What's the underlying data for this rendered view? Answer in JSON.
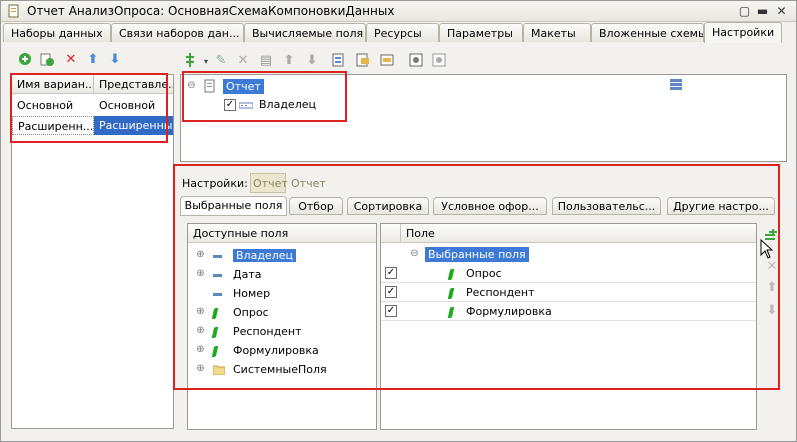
{
  "window": {
    "title": "Отчет АнализОпроса: ОсновнаяСхемаКомпоновкиДанных"
  },
  "tabs": [
    "Наборы данных",
    "Связи наборов дан...",
    "Вычисляемые поля",
    "Ресурсы",
    "Параметры",
    "Макеты",
    "Вложенные схемы",
    "Настройки"
  ],
  "variants": {
    "columns": [
      "Имя вариан...",
      "Представле..."
    ],
    "rows": [
      {
        "name": "Основной",
        "presentation": "Основной"
      },
      {
        "name": "Расширенн...",
        "presentation": "Расширенный"
      }
    ]
  },
  "structure": {
    "root": "Отчет",
    "child": "Владелец"
  },
  "settings": {
    "label": "Настройки:",
    "mode_active": "Отчет",
    "mode_other": "Отчет"
  },
  "subtabs": [
    "Выбранные поля",
    "Отбор",
    "Сортировка",
    "Условное офор...",
    "Пользовательс...",
    "Другие настро..."
  ],
  "available": {
    "header": "Доступные поля",
    "items": [
      {
        "label": "Владелец",
        "icon": "field-icon",
        "expand": true
      },
      {
        "label": "Дата",
        "icon": "field-icon",
        "expand": true
      },
      {
        "label": "Номер",
        "icon": "field-icon",
        "expand": false
      },
      {
        "label": "Опрос",
        "icon": "leaf-icon",
        "expand": true
      },
      {
        "label": "Респондент",
        "icon": "leaf-icon",
        "expand": true
      },
      {
        "label": "Формулировка",
        "icon": "leaf-icon",
        "expand": true
      },
      {
        "label": "СистемныеПоля",
        "icon": "folder-icon",
        "expand": true
      }
    ]
  },
  "selected": {
    "header": "Поле",
    "group": "Выбранные поля",
    "items": [
      "Опрос",
      "Респондент",
      "Формулировка"
    ]
  }
}
